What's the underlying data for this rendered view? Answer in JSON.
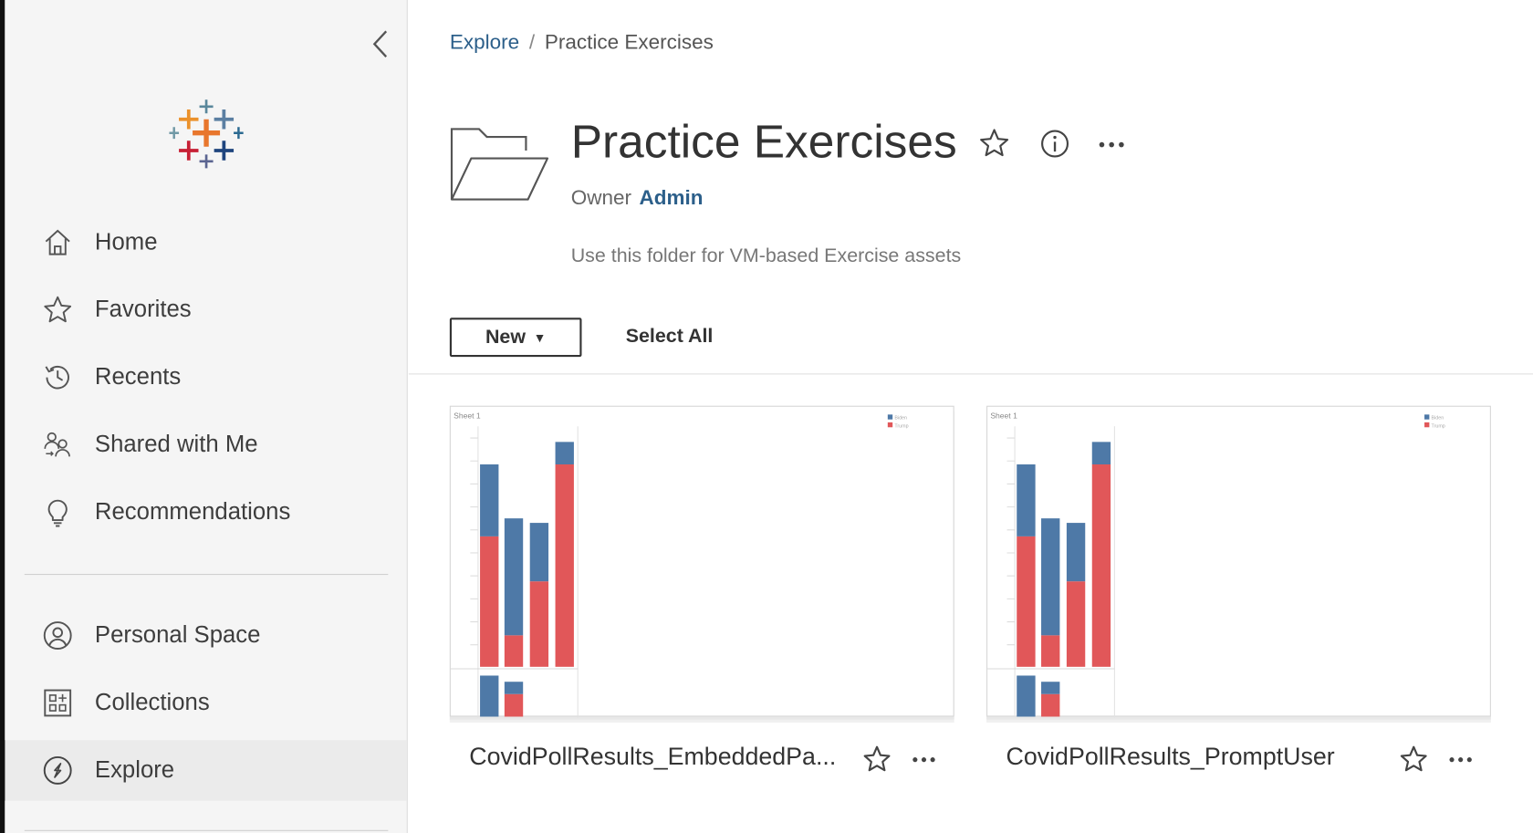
{
  "colors": {
    "link": "#2c5f8a",
    "bar_blue": "#4e79a7",
    "bar_red": "#e15759",
    "sidebar_bg": "#f5f5f5"
  },
  "sidebar": {
    "collapse_icon": "chevron-left-icon",
    "logo": "tableau-logo",
    "items": [
      {
        "label": "Home",
        "icon": "home-icon"
      },
      {
        "label": "Favorites",
        "icon": "star-icon"
      },
      {
        "label": "Recents",
        "icon": "history-icon"
      },
      {
        "label": "Shared with Me",
        "icon": "shared-users-icon"
      },
      {
        "label": "Recommendations",
        "icon": "lightbulb-icon"
      },
      {
        "label": "Personal Space",
        "icon": "user-circle-icon"
      },
      {
        "label": "Collections",
        "icon": "collections-grid-icon"
      },
      {
        "label": "Explore",
        "icon": "compass-icon",
        "active": true
      }
    ]
  },
  "breadcrumb": {
    "root": "Explore",
    "separator": "/",
    "current": "Practice Exercises"
  },
  "header": {
    "title": "Practice Exercises",
    "owner_label": "Owner",
    "owner_name": "Admin",
    "description": "Use this folder for VM-based Exercise assets"
  },
  "toolbar": {
    "new_label": "New",
    "new_caret": "▼",
    "select_all_label": "Select All"
  },
  "cards": [
    {
      "name": "CovidPollResults_EmbeddedPa...",
      "thumbnail": {
        "sheet": "Sheet 1",
        "legend": [
          "Biden",
          "Trump"
        ],
        "stacks": [
          [
            0.58,
            0.32
          ],
          [
            0.14,
            0.52
          ],
          [
            0.38,
            0.26
          ],
          [
            0.9,
            0.1
          ]
        ],
        "lower": [
          [
            0,
            1
          ],
          [
            0.55,
            0.3
          ]
        ]
      }
    },
    {
      "name": "CovidPollResults_PromptUser",
      "thumbnail": {
        "sheet": "Sheet 1",
        "legend": [
          "Biden",
          "Trump"
        ],
        "stacks": [
          [
            0.58,
            0.32
          ],
          [
            0.14,
            0.52
          ],
          [
            0.38,
            0.26
          ],
          [
            0.9,
            0.1
          ]
        ],
        "lower": [
          [
            0,
            1
          ],
          [
            0.55,
            0.3
          ]
        ]
      }
    }
  ]
}
